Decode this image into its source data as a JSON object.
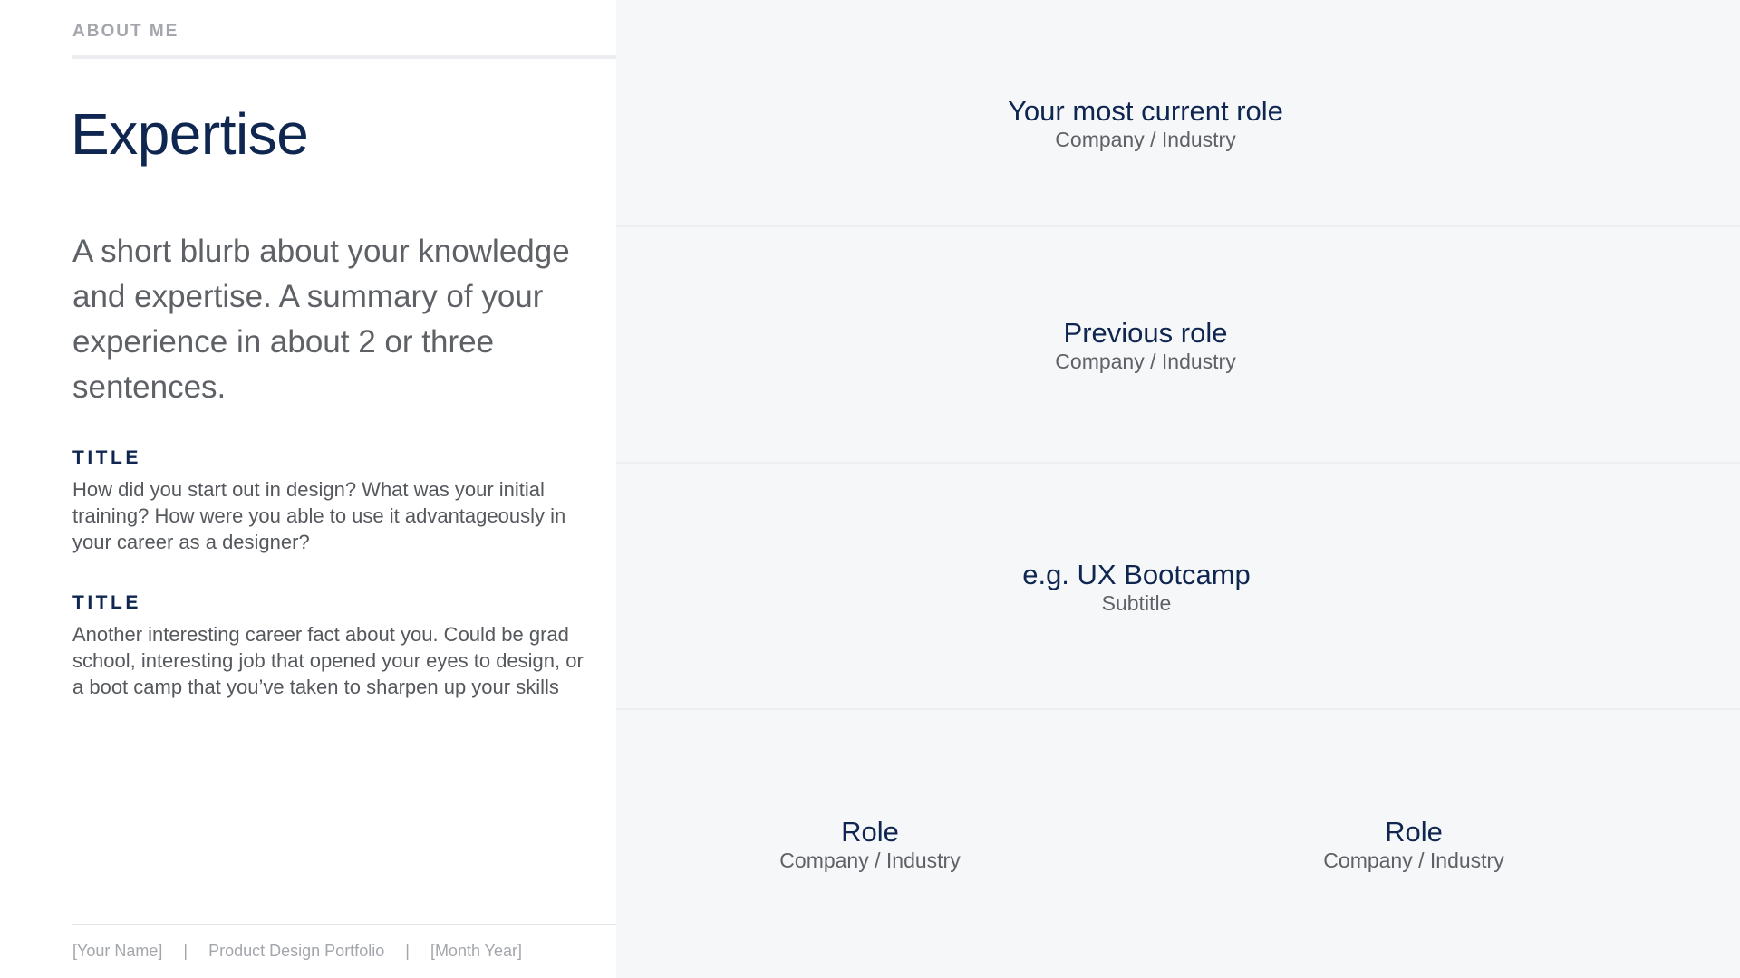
{
  "header": {
    "section_label": "ABOUT ME"
  },
  "main": {
    "title": "Expertise",
    "blurb": "A short blurb about your knowledge and expertise. A summary of your experience in about 2 or three sentences.",
    "sections": [
      {
        "title": "TITLE",
        "body": "How did you start out in design? What was your initial training? How were you able to use it advantageously in your career as a designer?"
      },
      {
        "title": "TITLE",
        "body": "Another interesting career fact about you. Could be grad school, interesting job that opened your eyes to design, or a boot camp that you’ve taken to sharpen up your skills"
      }
    ]
  },
  "footer": {
    "name": "[Your Name]",
    "separator": "|",
    "portfolio": "Product Design Portfolio",
    "date": "[Month Year]"
  },
  "roles": {
    "current": {
      "title": "Your most current role",
      "subtitle": "Company / Industry"
    },
    "previous": {
      "title": "Previous role",
      "subtitle": "Company / Industry"
    },
    "education": {
      "title": "e.g. UX Bootcamp",
      "subtitle": "Subtitle"
    },
    "bottom": [
      {
        "title": "Role",
        "subtitle": "Company / Industry"
      },
      {
        "title": "Role",
        "subtitle": "Company / Industry"
      }
    ]
  }
}
